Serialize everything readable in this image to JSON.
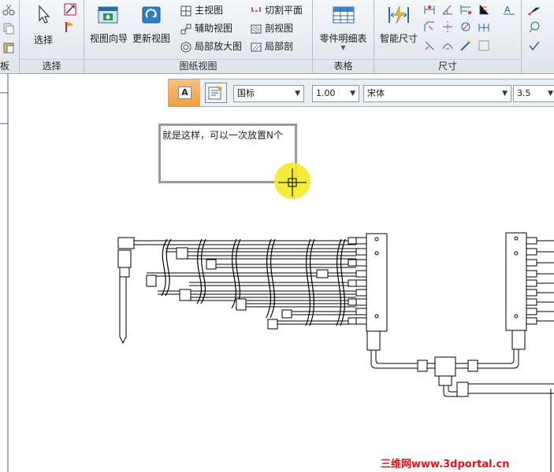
{
  "ribbon": {
    "group_select": {
      "label": "选择",
      "button": "选择"
    },
    "group_views": {
      "label": "图纸视图",
      "view_wizard": "视图向导",
      "update_views": "更新视图",
      "main_view": "主视图",
      "aux_view": "辅助视图",
      "detail_view": "局部放大图",
      "section_plane": "切割平面",
      "section_view": "剖视图",
      "partial_section": "局部剖"
    },
    "group_tables": {
      "label": "表格",
      "parts_list": "零件明细表"
    },
    "group_dimension": {
      "label": "尺寸",
      "smart_dimension": "智能尺寸"
    },
    "left_partial_label": "板"
  },
  "toolbar": {
    "standard": "国标",
    "scale": "1.00",
    "font": "宋体",
    "size": "3.5"
  },
  "canvas": {
    "text_note": "就是这样，可以一次放置N个"
  },
  "watermark": "三维网www.3dportal.cn"
}
